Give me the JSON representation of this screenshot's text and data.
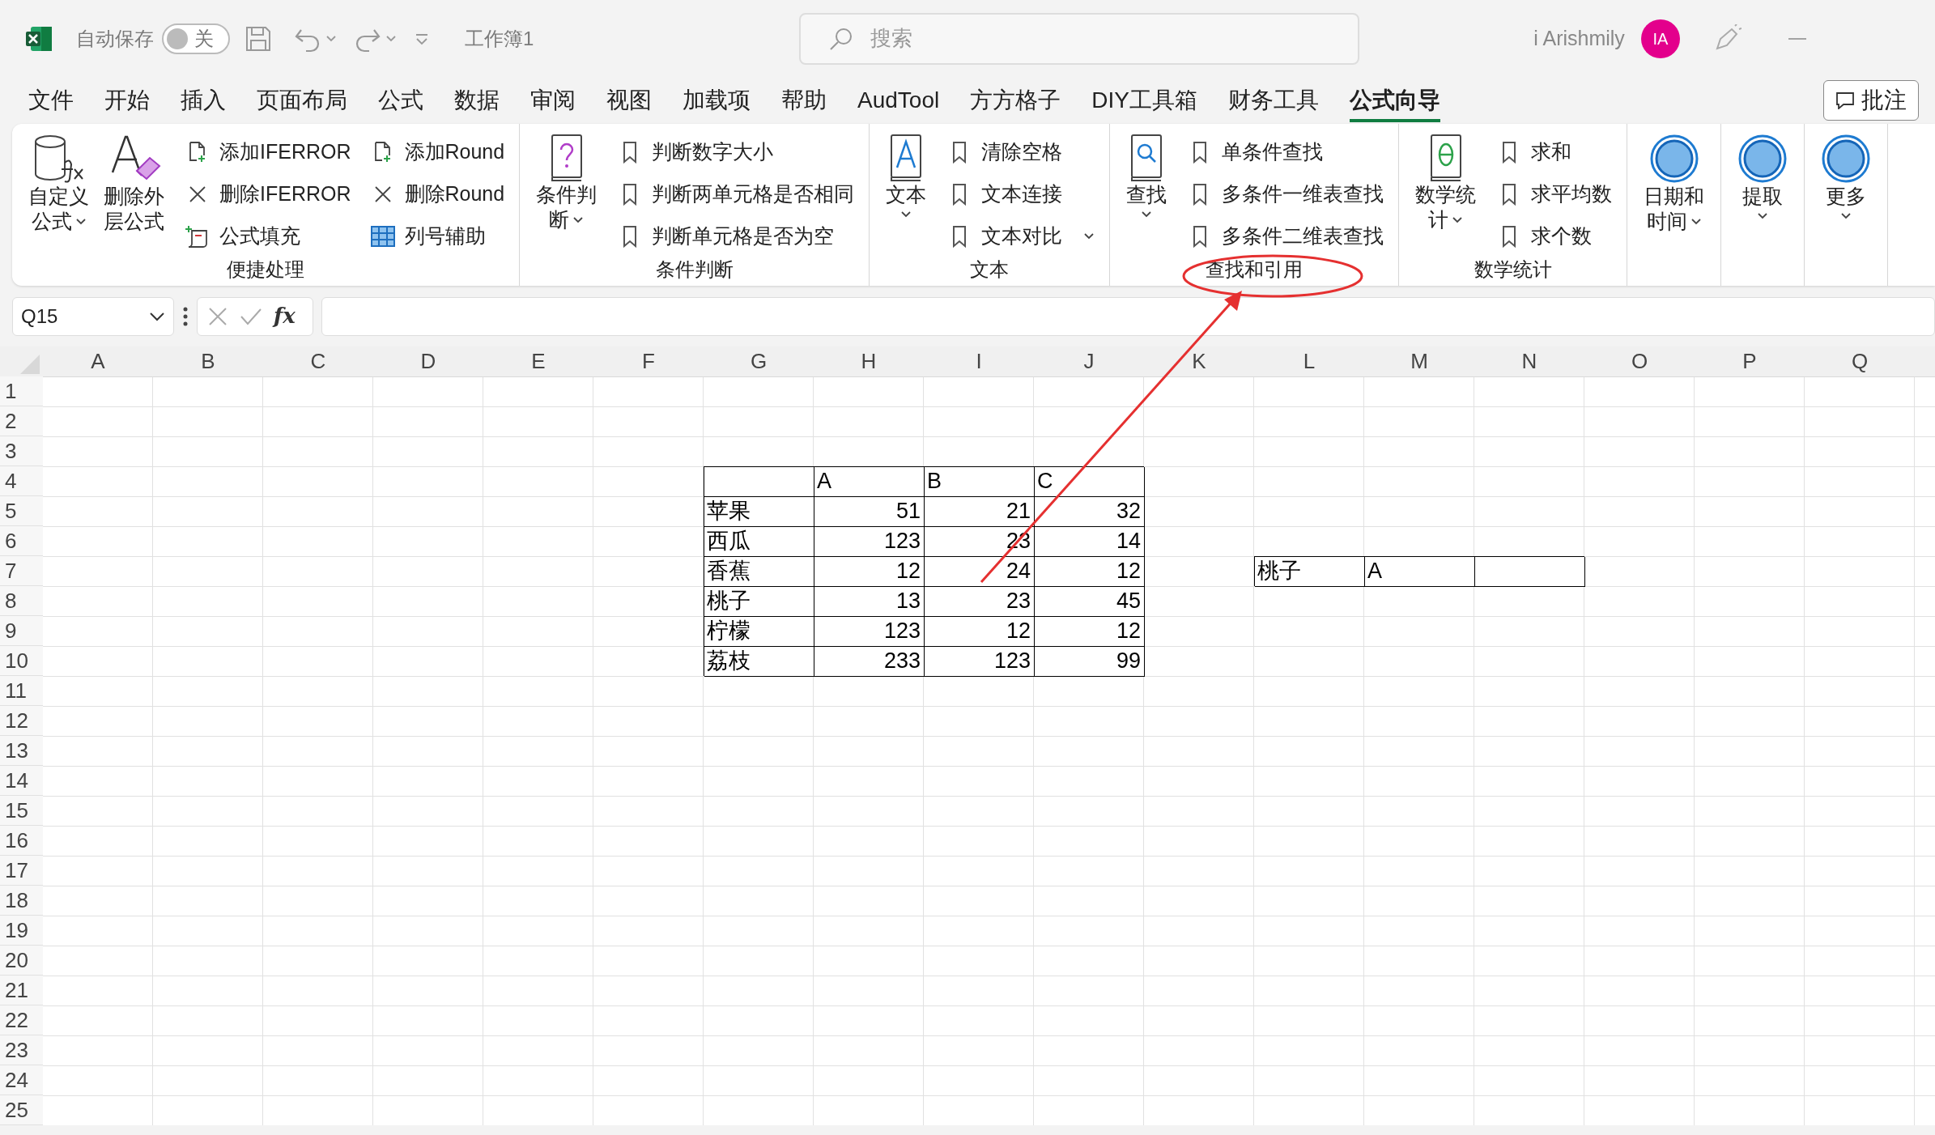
{
  "title_bar": {
    "autosave_label": "自动保存",
    "autosave_toggle": {
      "label": "关",
      "on": false
    },
    "workbook": "工作簿1",
    "search": {
      "placeholder": "搜索"
    },
    "user": "i Arishmily",
    "avatar": "IA"
  },
  "menu_tabs": [
    {
      "label": "文件",
      "selected": false
    },
    {
      "label": "开始",
      "selected": false
    },
    {
      "label": "插入",
      "selected": false
    },
    {
      "label": "页面布局",
      "selected": false
    },
    {
      "label": "公式",
      "selected": false
    },
    {
      "label": "数据",
      "selected": false
    },
    {
      "label": "审阅",
      "selected": false
    },
    {
      "label": "视图",
      "selected": false
    },
    {
      "label": "加载项",
      "selected": false
    },
    {
      "label": "帮助",
      "selected": false
    },
    {
      "label": "AudTool",
      "selected": false
    },
    {
      "label": "方方格子",
      "selected": false
    },
    {
      "label": "DIY工具箱",
      "selected": false
    },
    {
      "label": "财务工具",
      "selected": false
    },
    {
      "label": "公式向导",
      "selected": true
    }
  ],
  "comment_button": "批注",
  "ribbon": [
    {
      "label": "便捷处理",
      "large": [
        {
          "kind": "cylinder",
          "lines": [
            "自定义",
            "公式"
          ],
          "dropdown": true
        },
        {
          "kind": "eraser",
          "lines": [
            "删除外",
            "层公式"
          ],
          "dropdown": false
        }
      ],
      "columns": [
        [
          {
            "kind": "doc-plus",
            "label": "添加IFERROR",
            "dropdown": false
          },
          {
            "kind": "cross",
            "label": "删除IFERROR",
            "dropdown": false
          },
          {
            "kind": "fill",
            "label": "公式填充",
            "dropdown": false
          }
        ],
        [
          {
            "kind": "doc-plus",
            "label": "添加Round",
            "dropdown": false
          },
          {
            "kind": "cross",
            "label": "删除Round",
            "dropdown": false
          },
          {
            "kind": "grid",
            "label": "列号辅助",
            "dropdown": false
          }
        ]
      ]
    },
    {
      "label": "条件判断",
      "large": [
        {
          "kind": "question-book",
          "lines": [
            "条件判",
            "断"
          ],
          "dropdown": true
        }
      ],
      "columns": [
        [
          {
            "kind": "bookmark",
            "label": "判断数字大小",
            "dropdown": false
          },
          {
            "kind": "bookmark",
            "label": "判断两单元格是否相同",
            "dropdown": false
          },
          {
            "kind": "bookmark",
            "label": "判断单元格是否为空",
            "dropdown": false
          }
        ]
      ]
    },
    {
      "label": "文本",
      "large": [
        {
          "kind": "a-book",
          "lines": [
            "文本"
          ],
          "dropdown": true
        }
      ],
      "columns": [
        [
          {
            "kind": "bookmark",
            "label": "清除空格",
            "dropdown": false
          },
          {
            "kind": "bookmark",
            "label": "文本连接",
            "dropdown": false
          },
          {
            "kind": "bookmark",
            "label": "文本对比",
            "dropdown": true
          }
        ]
      ]
    },
    {
      "label": "查找和引用",
      "large": [
        {
          "kind": "search-book",
          "lines": [
            "查找"
          ],
          "dropdown": true
        }
      ],
      "columns": [
        [
          {
            "kind": "bookmark",
            "label": "单条件查找",
            "dropdown": false
          },
          {
            "kind": "bookmark",
            "label": "多条件一维表查找",
            "dropdown": false
          },
          {
            "kind": "bookmark",
            "label": "多条件二维表查找",
            "dropdown": false
          }
        ]
      ]
    },
    {
      "label": "数学统计",
      "large": [
        {
          "kind": "theta-book",
          "lines": [
            "数学统",
            "计"
          ],
          "dropdown": true
        }
      ],
      "columns": [
        [
          {
            "kind": "bookmark",
            "label": "求和",
            "dropdown": false
          },
          {
            "kind": "bookmark",
            "label": "求平均数",
            "dropdown": false
          },
          {
            "kind": "bookmark",
            "label": "求个数",
            "dropdown": false
          }
        ]
      ]
    },
    {
      "large": [
        {
          "kind": "circle",
          "lines": [
            "日期和",
            "时间"
          ],
          "dropdown": true
        }
      ]
    },
    {
      "large": [
        {
          "kind": "circle",
          "lines": [
            "提取"
          ],
          "dropdown": true
        }
      ]
    },
    {
      "large": [
        {
          "kind": "circle",
          "lines": [
            "更多"
          ],
          "dropdown": true
        }
      ]
    }
  ],
  "formula_bar": {
    "name_box": "Q15",
    "fx": "fx"
  },
  "sheet": {
    "columns": [
      "A",
      "B",
      "C",
      "D",
      "E",
      "F",
      "G",
      "H",
      "I",
      "J",
      "K",
      "L",
      "M",
      "N",
      "O",
      "P",
      "Q"
    ],
    "rows": [
      "1",
      "2",
      "3",
      "4",
      "5",
      "6",
      "7",
      "8",
      "9",
      "10",
      "11",
      "12",
      "13",
      "14",
      "15",
      "16",
      "17",
      "18",
      "19",
      "20",
      "21",
      "22",
      "23",
      "24",
      "25"
    ],
    "fruit_table": {
      "header": [
        "A",
        "B",
        "C"
      ],
      "rows": [
        {
          "label": "苹果",
          "values": [
            "51",
            "21",
            "32"
          ]
        },
        {
          "label": "西瓜",
          "values": [
            "123",
            "23",
            "14"
          ]
        },
        {
          "label": "香蕉",
          "values": [
            "12",
            "24",
            "12"
          ]
        },
        {
          "label": "桃子",
          "values": [
            "13",
            "23",
            "45"
          ]
        },
        {
          "label": "柠檬",
          "values": [
            "123",
            "12",
            "12"
          ]
        },
        {
          "label": "荔枝",
          "values": [
            "233",
            "123",
            "99"
          ]
        }
      ]
    },
    "lookup_row": {
      "label": "桃子",
      "column": "A"
    }
  }
}
